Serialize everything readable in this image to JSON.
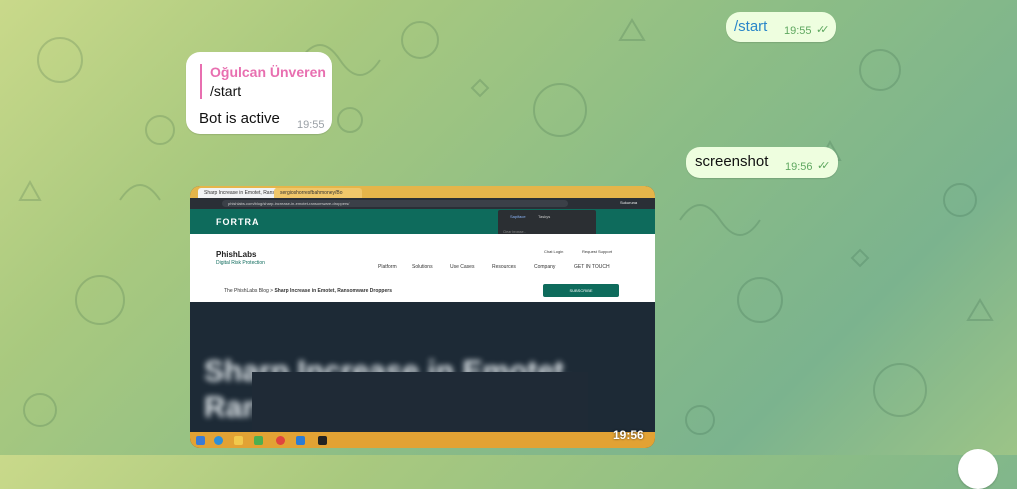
{
  "messages": {
    "start_cmd": {
      "text": "/start",
      "time": "19:55"
    },
    "bot_reply": {
      "reply_name": "Oğulcan Ünveren",
      "reply_text": "/start",
      "text": "Bot is active",
      "time": "19:55"
    },
    "screenshot_cmd": {
      "text": "screenshot",
      "time": "19:56"
    },
    "image": {
      "time": "19:56"
    }
  },
  "screenshot_content": {
    "tab1": "Sharp Increase in Emotet, Ranso",
    "tab2": "sergioshorresfbahmoney/Bo",
    "url": "phishlabs.com/blog/sharp-increase-in-emotet-ransomware-droppers/",
    "fortra_logo": "FORTRA",
    "brand": "PhishLabs",
    "brand_sub": "Digital Risk Protection",
    "chat_login": "Chat Login",
    "request_support": "Request Support",
    "nav": [
      "Platform",
      "Solutions",
      "Use Cases",
      "Resources",
      "Company",
      "GET IN TOUCH"
    ],
    "breadcrumb_prefix": "The PhishLabs Blog > ",
    "breadcrumb_current": "Sharp Increase in Emotet, Ransomware Droppers",
    "subscribe": "SUBSCRIBE",
    "hero_title_1": "Sharp Increase in Emotet,",
    "hero_title_2": "Ran",
    "dropdown_tab1": "Sapiface",
    "dropdown_tab2": "Taskys",
    "dropdown_item": "Clear browse..",
    "profile": "Sukuruna"
  },
  "colors": {
    "outgoing_bubble": "#eefedf",
    "incoming_bubble": "#ffffff",
    "reply_accent": "#e86fb0",
    "fortra_green": "#0e6b5c"
  }
}
